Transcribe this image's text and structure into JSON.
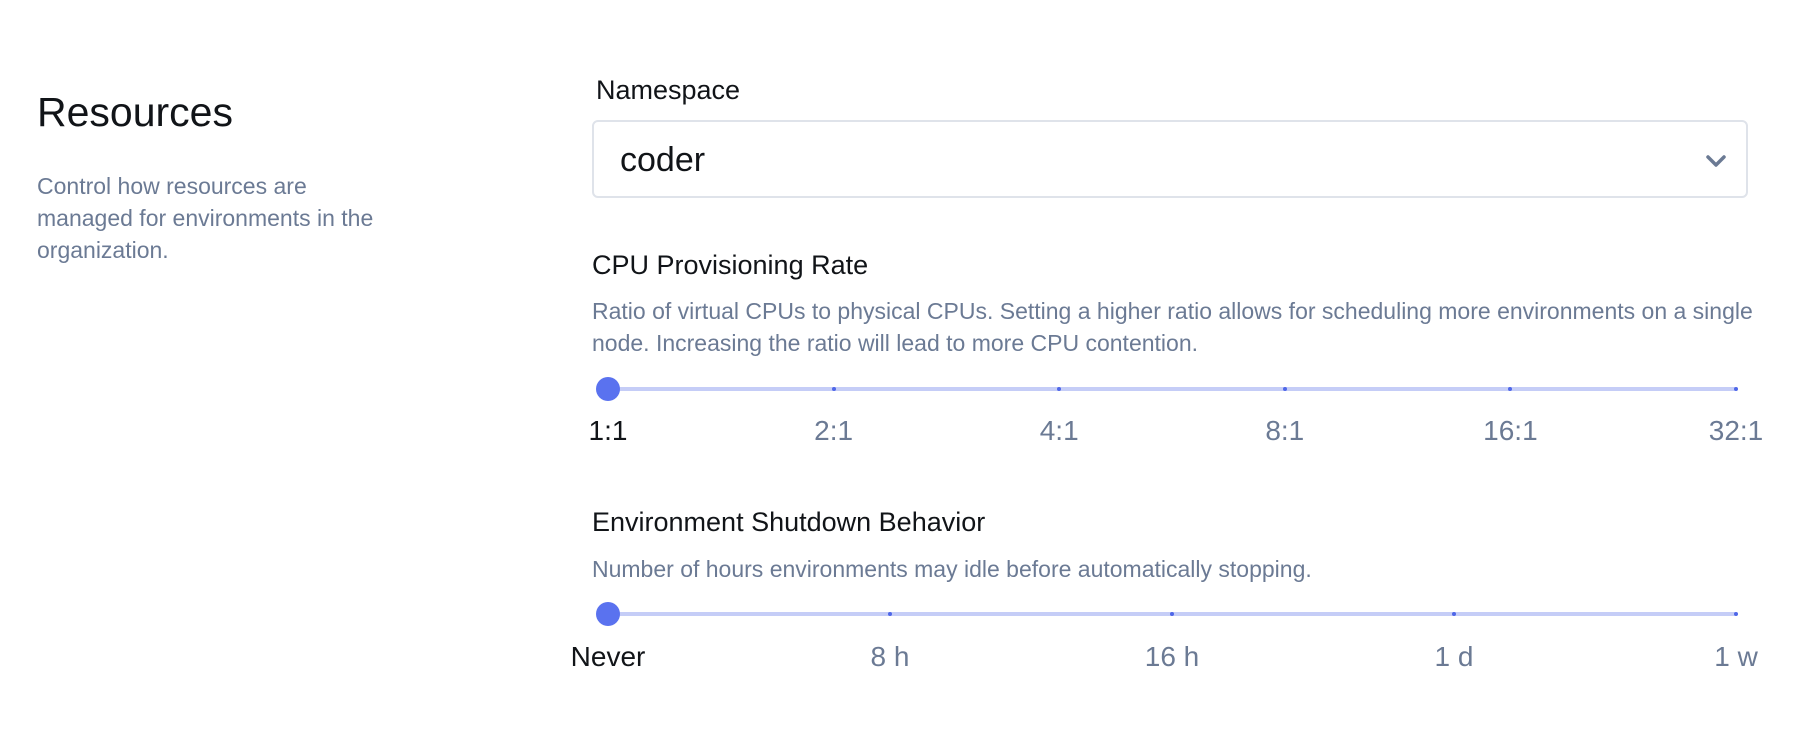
{
  "section": {
    "title": "Resources",
    "description": "Control how resources are managed for environments in the organization."
  },
  "namespace": {
    "label": "Namespace",
    "value": "coder",
    "icon": "chevron-down-icon"
  },
  "cpu": {
    "label": "CPU Provisioning Rate",
    "description": "Ratio of virtual CPUs to physical CPUs. Setting a higher ratio allows for scheduling more environments on a single node. Increasing the ratio will lead to more CPU contention.",
    "marks": [
      "1:1",
      "2:1",
      "4:1",
      "8:1",
      "16:1",
      "32:1"
    ],
    "selected_index": 0
  },
  "shutdown": {
    "label": "Environment Shutdown Behavior",
    "description": "Number of hours environments may idle before automatically stopping.",
    "marks": [
      "Never",
      "8 h",
      "16 h",
      "1 d",
      "1 w"
    ],
    "selected_index": 0
  },
  "colors": {
    "accent": "#5a72ef",
    "track": "#c5cdf7",
    "muted_text": "#6b7a94",
    "text": "#111418"
  }
}
